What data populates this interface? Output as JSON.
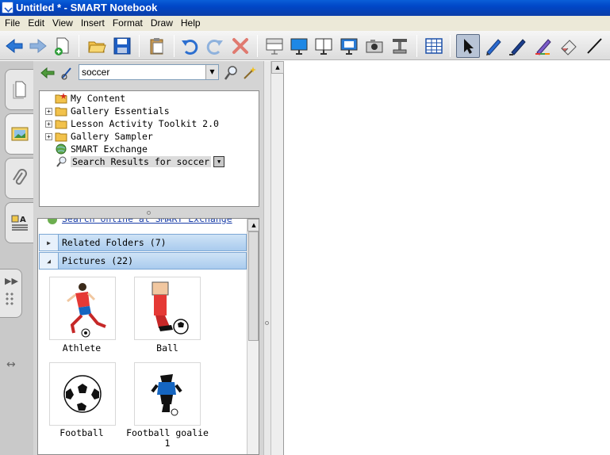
{
  "window": {
    "title": "Untitled * - SMART Notebook"
  },
  "menu": [
    "File",
    "Edit",
    "View",
    "Insert",
    "Format",
    "Draw",
    "Help"
  ],
  "toolbar": {
    "buttons": [
      "back",
      "forward",
      "add-page",
      "open",
      "save",
      "paste",
      "undo",
      "redo",
      "delete",
      "screen-shade",
      "full-screen",
      "dual-page",
      "doc-camera",
      "capture",
      "table",
      "select",
      "pen",
      "creative-pen",
      "highlighter",
      "eraser",
      "line"
    ],
    "active": "select"
  },
  "gallery": {
    "search": {
      "value": "soccer"
    },
    "tree": [
      {
        "label": "My Content",
        "expandable": false,
        "icon": "my-content-folder-icon"
      },
      {
        "label": "Gallery Essentials",
        "expandable": true,
        "icon": "folder-icon"
      },
      {
        "label": "Lesson Activity Toolkit 2.0",
        "expandable": true,
        "icon": "folder-icon"
      },
      {
        "label": "Gallery Sampler",
        "expandable": true,
        "icon": "folder-icon"
      },
      {
        "label": "SMART Exchange",
        "expandable": false,
        "icon": "globe-icon"
      },
      {
        "label": "Search Results for soccer",
        "expandable": false,
        "icon": "search-icon",
        "selected": true
      }
    ],
    "online_link": "Search online at SMART Exchange",
    "sections": [
      {
        "label": "Related Folders (7)",
        "expanded": false
      },
      {
        "label": "Pictures (22)",
        "expanded": true
      }
    ],
    "pictures": [
      {
        "label": "Athlete"
      },
      {
        "label": "Ball"
      },
      {
        "label": "Football"
      },
      {
        "label": "Football goalie",
        "label2": "1"
      }
    ]
  }
}
